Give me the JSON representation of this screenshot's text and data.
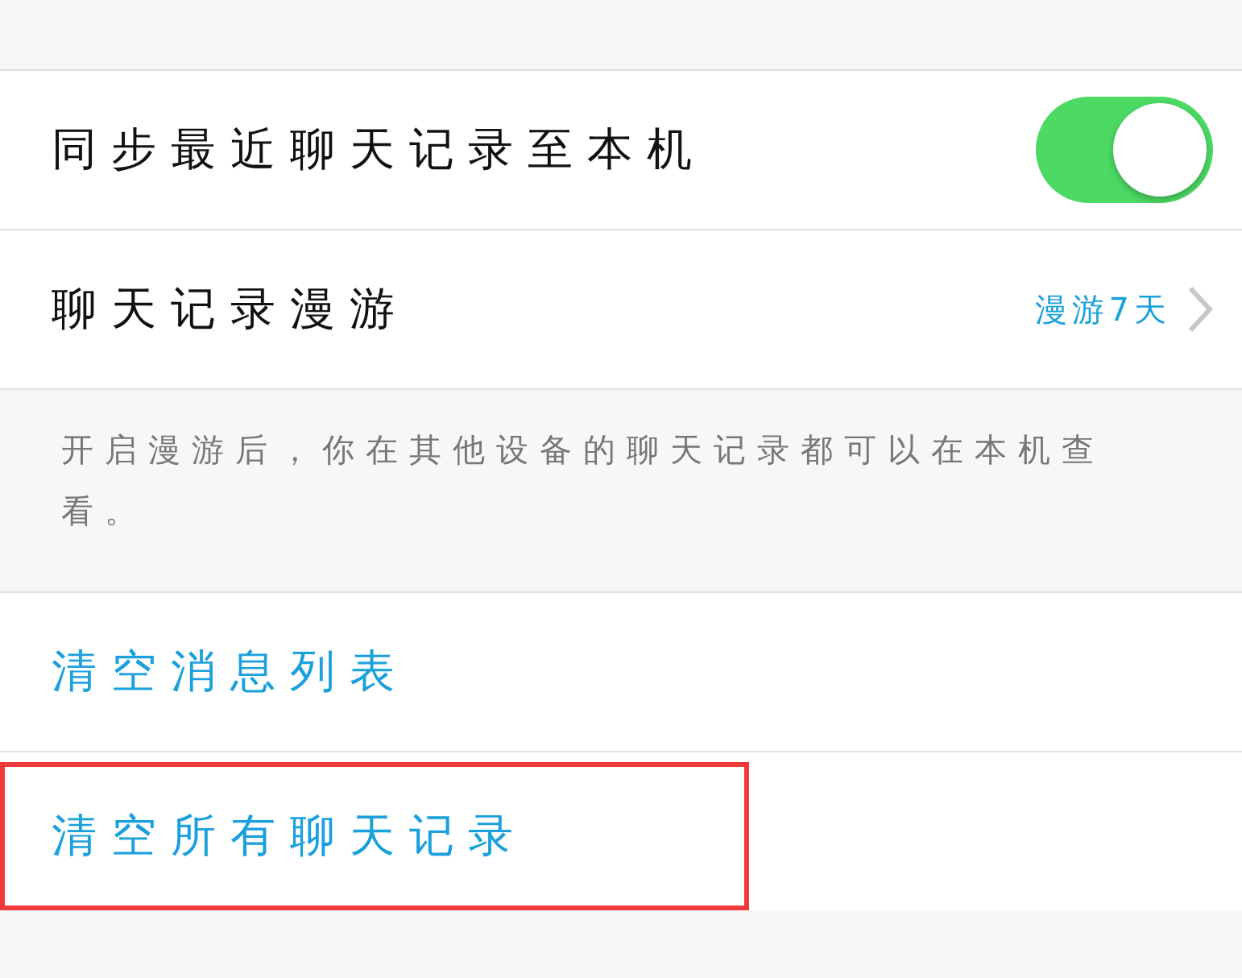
{
  "sync_section": {
    "rows": [
      {
        "kind": "toggle",
        "label": "同步最近聊天记录至本机",
        "on": true
      },
      {
        "kind": "link",
        "label": "聊天记录漫游",
        "value": "漫游7天"
      }
    ],
    "footer": "开启漫游后，你在其他设备的聊天记录都可以在本机查看。"
  },
  "actions": [
    {
      "label": "清空消息列表",
      "highlighted": false
    },
    {
      "label": "清空所有聊天记录",
      "highlighted": true
    }
  ]
}
